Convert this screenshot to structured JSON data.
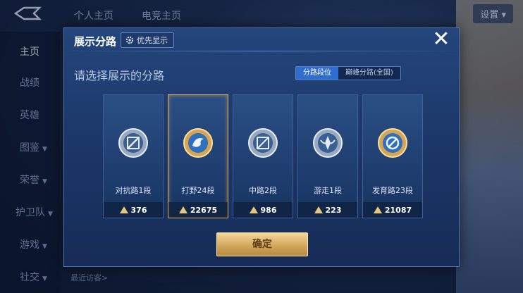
{
  "header": {
    "tabs": [
      "个人主页",
      "电竞主页"
    ],
    "settings_label": "设置 ▾"
  },
  "sidebar": {
    "items": [
      {
        "label": "主页",
        "active": true
      },
      {
        "label": "战绩"
      },
      {
        "label": "英雄"
      },
      {
        "label": "图鉴",
        "chevron": true
      },
      {
        "label": "荣誉",
        "chevron": true
      },
      {
        "label": "护卫队",
        "chevron": true
      },
      {
        "label": "游戏",
        "chevron": true
      },
      {
        "label": "社交",
        "chevron": true
      }
    ]
  },
  "footer": {
    "recent_visitors": "最近访客>"
  },
  "modal": {
    "title": "展示分路",
    "priority_button": "优先显示",
    "close_icon": "✕",
    "prompt": "请选择展示的分路",
    "segment_tabs": [
      {
        "label": "分路段位",
        "active": true
      },
      {
        "label": "巅峰分路(全国)",
        "active": false
      }
    ],
    "cards": [
      {
        "name": "对抗路1段",
        "value": "376",
        "selected": false,
        "badge": "silver",
        "icon": "swords-badge-icon"
      },
      {
        "name": "打野24段",
        "value": "22675",
        "selected": true,
        "badge": "gold",
        "icon": "dragon-badge-icon"
      },
      {
        "name": "中路2段",
        "value": "986",
        "selected": false,
        "badge": "silver",
        "icon": "mage-badge-icon"
      },
      {
        "name": "游走1段",
        "value": "223",
        "selected": false,
        "badge": "silver",
        "icon": "support-badge-icon"
      },
      {
        "name": "发育路23段",
        "value": "21087",
        "selected": false,
        "badge": "gold",
        "icon": "marksman-badge-icon"
      }
    ],
    "confirm_label": "确定"
  },
  "colors": {
    "accent_blue": "#2f6dd0",
    "gold": "#d2a85c"
  }
}
